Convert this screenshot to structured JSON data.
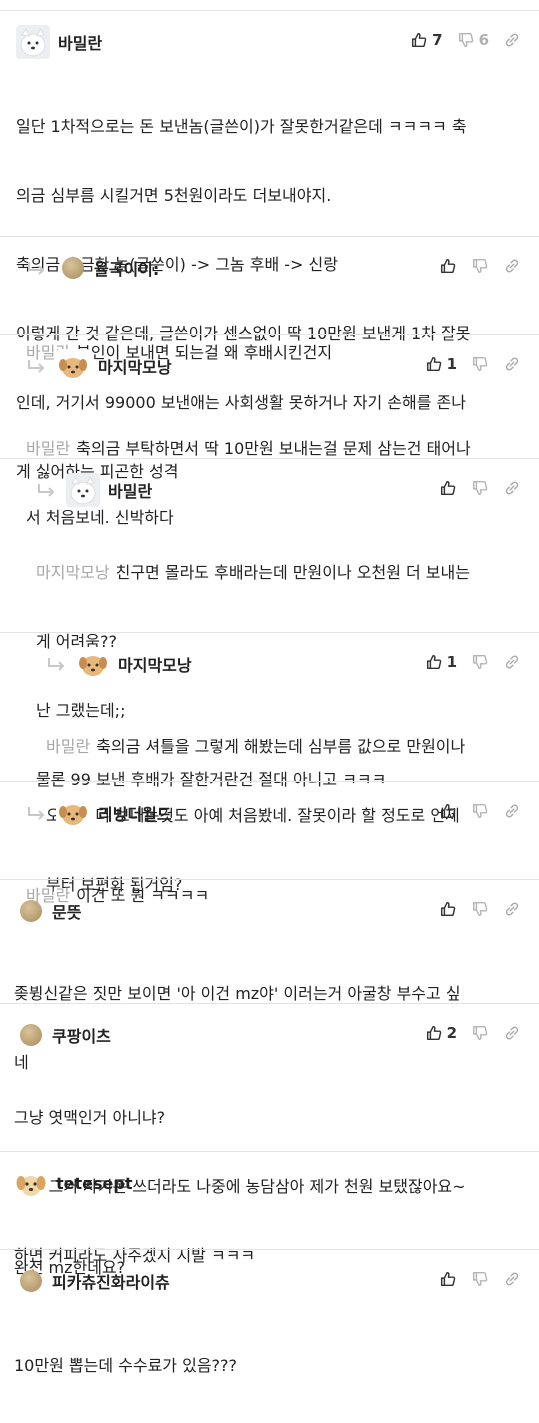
{
  "comments": [
    {
      "nick": "바밀란",
      "up": "7",
      "down": "6",
      "lines": [
        "일단 1차적으로는 돈 보낸놈(글쓴이)가 잘못한거같은데 ㅋㅋㅋㅋ 축",
        "의금 심부름 시킬거면 5천원이라도 더보내야지.",
        "축의금 송금한 놈(글쓴이) -> 그놈 후배 -> 신랑",
        "이렇게 간 것 같은데, 글쓴이가 센스없이 딱 10만원 보낸게 1차 잘못",
        "인데, 거기서 99000 보낸애는 사회생활 못하거나 자기 손해를 존나",
        "게 싫어하는 피곤한 성격"
      ]
    },
    {
      "nick": "율곡이이:",
      "mention": "바밀란",
      "lines": [
        "본인이 보내면 되는걸 왜 후배시킨건지"
      ]
    },
    {
      "nick": "마지막모낭",
      "up": "1",
      "mention": "바밀란",
      "lines": [
        "축의금 부탁하면서 딱 10만원 보내는걸 문제 삼는건 태어나",
        "서 처음보네. 신박하다"
      ]
    },
    {
      "nick": "바밀란",
      "mention": "마지막모낭",
      "lines": [
        "친구면 몰라도 후배라는데 만원이나 오천원 더 보내는",
        "게 어려움??",
        "난 그랬는데;;",
        "물론 99 보낸 후배가 잘한거란건 절대 아니고 ㅋㅋㅋ"
      ]
    },
    {
      "nick": "마지막모낭",
      "up": "1",
      "mention": "바밀란",
      "lines": [
        "축의금 셔틀을 그렇게 해봤는데 심부름 값으로 만원이나",
        "오천원 더 보내는것도 아예 처음봤네. 잘못이라 할 정도로 언제",
        "부터 보편화 된거임?"
      ]
    },
    {
      "nick": "리빙더월드",
      "mention": "바밀란",
      "lines": [
        "이건 또 뭔 ㅋㅋㅋㅋ"
      ]
    },
    {
      "nick": "문뜻",
      "lines": [
        "좆뷩신같은 짓만 보이면 '아 이건 mz야' 이러는거 아굴창 부수고 싶",
        "네"
      ]
    },
    {
      "nick": "쿠팡이츠",
      "up": "2",
      "lines": [
        "그냥 엿맥인거 아니냐?",
        "천원 그거 자기돈 쓰더라도 나중에 농담삼아 제가 천원 보탰잖아요~",
        "하면 커피라도 사주겠지 시발 ㅋㅋㅋ"
      ]
    },
    {
      "nick": "tetesept",
      "lines": [
        "완전 mz한데요?"
      ]
    },
    {
      "nick": "피카츄진화라이츄",
      "lines": [
        "10만원 뽑는데 수수료가 있음???"
      ]
    }
  ],
  "colors": {
    "text": "#222222",
    "muted": "#a8a8a8",
    "divider": "#e3e3e3"
  }
}
